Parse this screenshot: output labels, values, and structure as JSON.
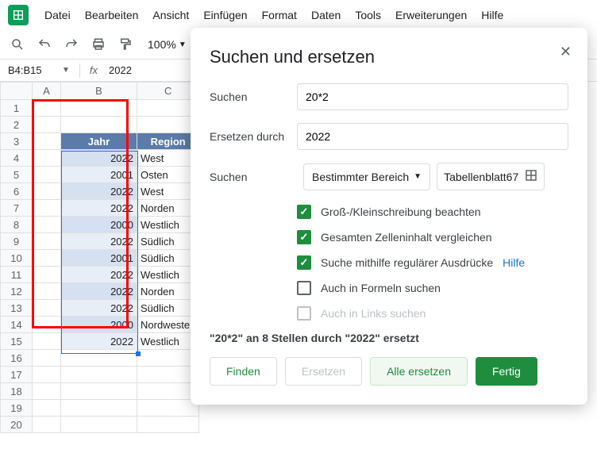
{
  "menu": {
    "items": [
      "Datei",
      "Bearbeiten",
      "Ansicht",
      "Einfügen",
      "Format",
      "Daten",
      "Tools",
      "Erweiterungen",
      "Hilfe"
    ]
  },
  "toolbar": {
    "zoom": "100%"
  },
  "formula": {
    "range": "B4:B15",
    "fx": "fx",
    "value": "2022"
  },
  "sheet": {
    "col_headers": [
      "A",
      "B",
      "C"
    ],
    "header_row": {
      "jahr": "Jahr",
      "region": "Region"
    },
    "rows": [
      {
        "n": 1
      },
      {
        "n": 2
      },
      {
        "n": 3,
        "header": true
      },
      {
        "n": 4,
        "year": "2022",
        "region": "West"
      },
      {
        "n": 5,
        "year": "2001",
        "region": "Osten"
      },
      {
        "n": 6,
        "year": "2022",
        "region": "West"
      },
      {
        "n": 7,
        "year": "2022",
        "region": "Norden"
      },
      {
        "n": 8,
        "year": "2000",
        "region": "Westlich"
      },
      {
        "n": 9,
        "year": "2022",
        "region": "Südlich"
      },
      {
        "n": 10,
        "year": "2001",
        "region": "Südlich"
      },
      {
        "n": 11,
        "year": "2022",
        "region": "Westlich"
      },
      {
        "n": 12,
        "year": "2022",
        "region": "Norden"
      },
      {
        "n": 13,
        "year": "2022",
        "region": "Südlich"
      },
      {
        "n": 14,
        "year": "2000",
        "region": "Nordwesten"
      },
      {
        "n": 15,
        "year": "2022",
        "region": "Westlich"
      },
      {
        "n": 16
      },
      {
        "n": 17
      },
      {
        "n": 18
      },
      {
        "n": 19
      },
      {
        "n": 20
      }
    ]
  },
  "dialog": {
    "title": "Suchen und ersetzen",
    "search_label": "Suchen",
    "search_value": "20*2",
    "replace_label": "Ersetzen durch",
    "replace_value": "2022",
    "scope_label": "Suchen",
    "scope_value": "Bestimmter Bereich",
    "range_value": "Tabellenblatt67",
    "checks": {
      "match_case": "Groß-/Kleinschreibung beachten",
      "entire_cell": "Gesamten Zelleninhalt vergleichen",
      "regex": "Suche mithilfe regulärer Ausdrücke",
      "regex_help": "Hilfe",
      "in_formulas": "Auch in Formeln suchen",
      "in_links": "Auch in Links suchen"
    },
    "status": "\"20*2\" an 8 Stellen durch \"2022\" ersetzt",
    "buttons": {
      "find": "Finden",
      "replace": "Ersetzen",
      "replace_all": "Alle ersetzen",
      "done": "Fertig"
    }
  }
}
